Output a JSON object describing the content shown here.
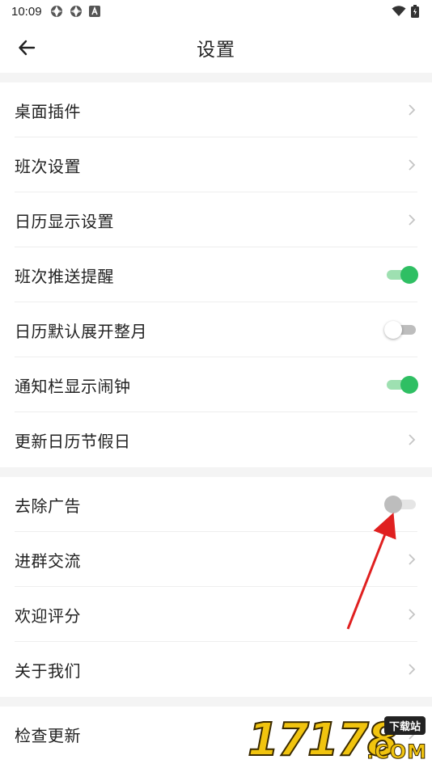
{
  "status_bar": {
    "time": "10:09",
    "left_icons": [
      "shutter-icon",
      "shutter-icon",
      "a-box-icon"
    ],
    "right_icons": [
      "wifi-icon",
      "battery-icon"
    ]
  },
  "header": {
    "title": "设置"
  },
  "sections": [
    {
      "rows": [
        {
          "label": "桌面插件",
          "control": "chevron"
        },
        {
          "label": "班次设置",
          "control": "chevron"
        },
        {
          "label": "日历显示设置",
          "control": "chevron"
        },
        {
          "label": "班次推送提醒",
          "control": "toggle",
          "state": "on"
        },
        {
          "label": "日历默认展开整月",
          "control": "toggle",
          "state": "off"
        },
        {
          "label": "通知栏显示闹钟",
          "control": "toggle",
          "state": "on"
        },
        {
          "label": "更新日历节假日",
          "control": "chevron"
        }
      ]
    },
    {
      "rows": [
        {
          "label": "去除广告",
          "control": "toggle",
          "state": "disabled"
        },
        {
          "label": "进群交流",
          "control": "chevron"
        },
        {
          "label": "欢迎评分",
          "control": "chevron"
        },
        {
          "label": "关于我们",
          "control": "chevron"
        }
      ]
    },
    {
      "rows": [
        {
          "label": "检查更新",
          "control": "chevron"
        }
      ]
    }
  ],
  "colors": {
    "toggle_on_thumb": "#2fbf63",
    "toggle_on_track": "#9ee0b1",
    "section_gap": "#f4f4f4",
    "annotation_arrow": "#e02020"
  },
  "watermark": {
    "text": "17178",
    "badge": "下载站",
    "suffix": ".COM"
  }
}
